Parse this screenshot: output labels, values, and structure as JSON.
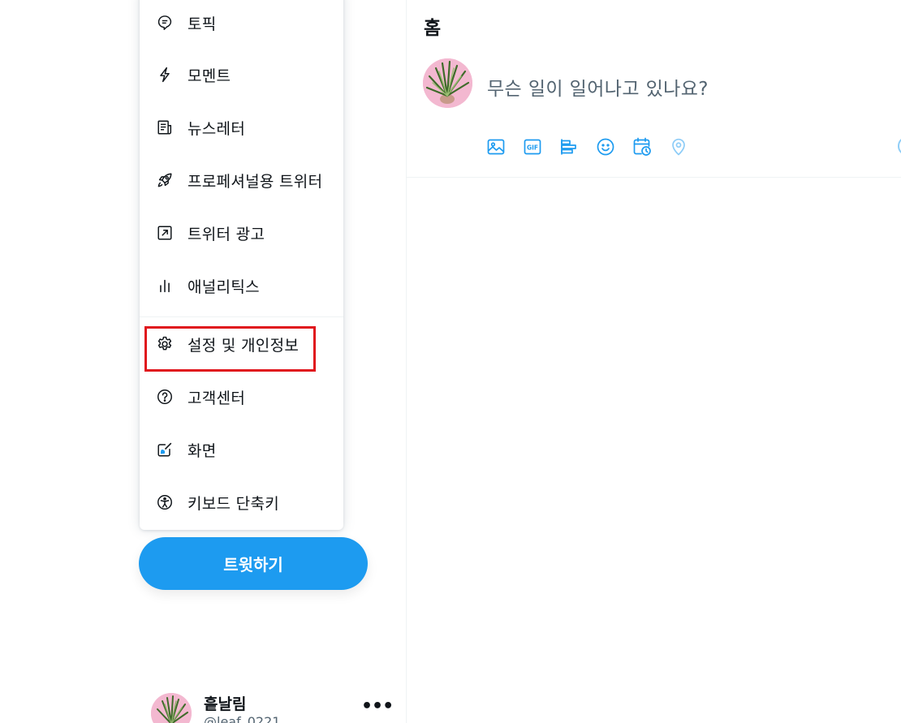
{
  "menu": {
    "items": [
      {
        "label": "토픽",
        "icon": "topics-icon"
      },
      {
        "label": "모멘트",
        "icon": "moments-icon"
      },
      {
        "label": "뉴스레터",
        "icon": "newsletter-icon"
      },
      {
        "label": "프로페셔널용 트위터",
        "icon": "rocket-icon"
      },
      {
        "label": "트위터 광고",
        "icon": "ads-icon"
      },
      {
        "label": "애널리틱스",
        "icon": "analytics-icon"
      },
      {
        "label": "설정 및 개인정보",
        "icon": "gear-icon",
        "highlighted": true
      },
      {
        "label": "고객센터",
        "icon": "help-icon"
      },
      {
        "label": "화면",
        "icon": "display-icon"
      },
      {
        "label": "키보드 단축키",
        "icon": "accessibility-icon"
      }
    ],
    "highlight_color": "#e0151d"
  },
  "tweet_button": {
    "label": "트윗하기",
    "color": "#1d9bf0"
  },
  "account": {
    "name": "흩날림",
    "handle": "@leaf_0221",
    "more_icon": "more-dots-icon"
  },
  "home": {
    "title": "홈"
  },
  "composer": {
    "placeholder": "무슨 일이 일어나고 있나요?",
    "tools": [
      {
        "icon": "image-icon"
      },
      {
        "icon": "gif-icon"
      },
      {
        "icon": "poll-icon"
      },
      {
        "icon": "emoji-icon"
      },
      {
        "icon": "schedule-icon"
      },
      {
        "icon": "location-icon",
        "disabled": true
      }
    ],
    "accent": "#1d9bf0"
  }
}
